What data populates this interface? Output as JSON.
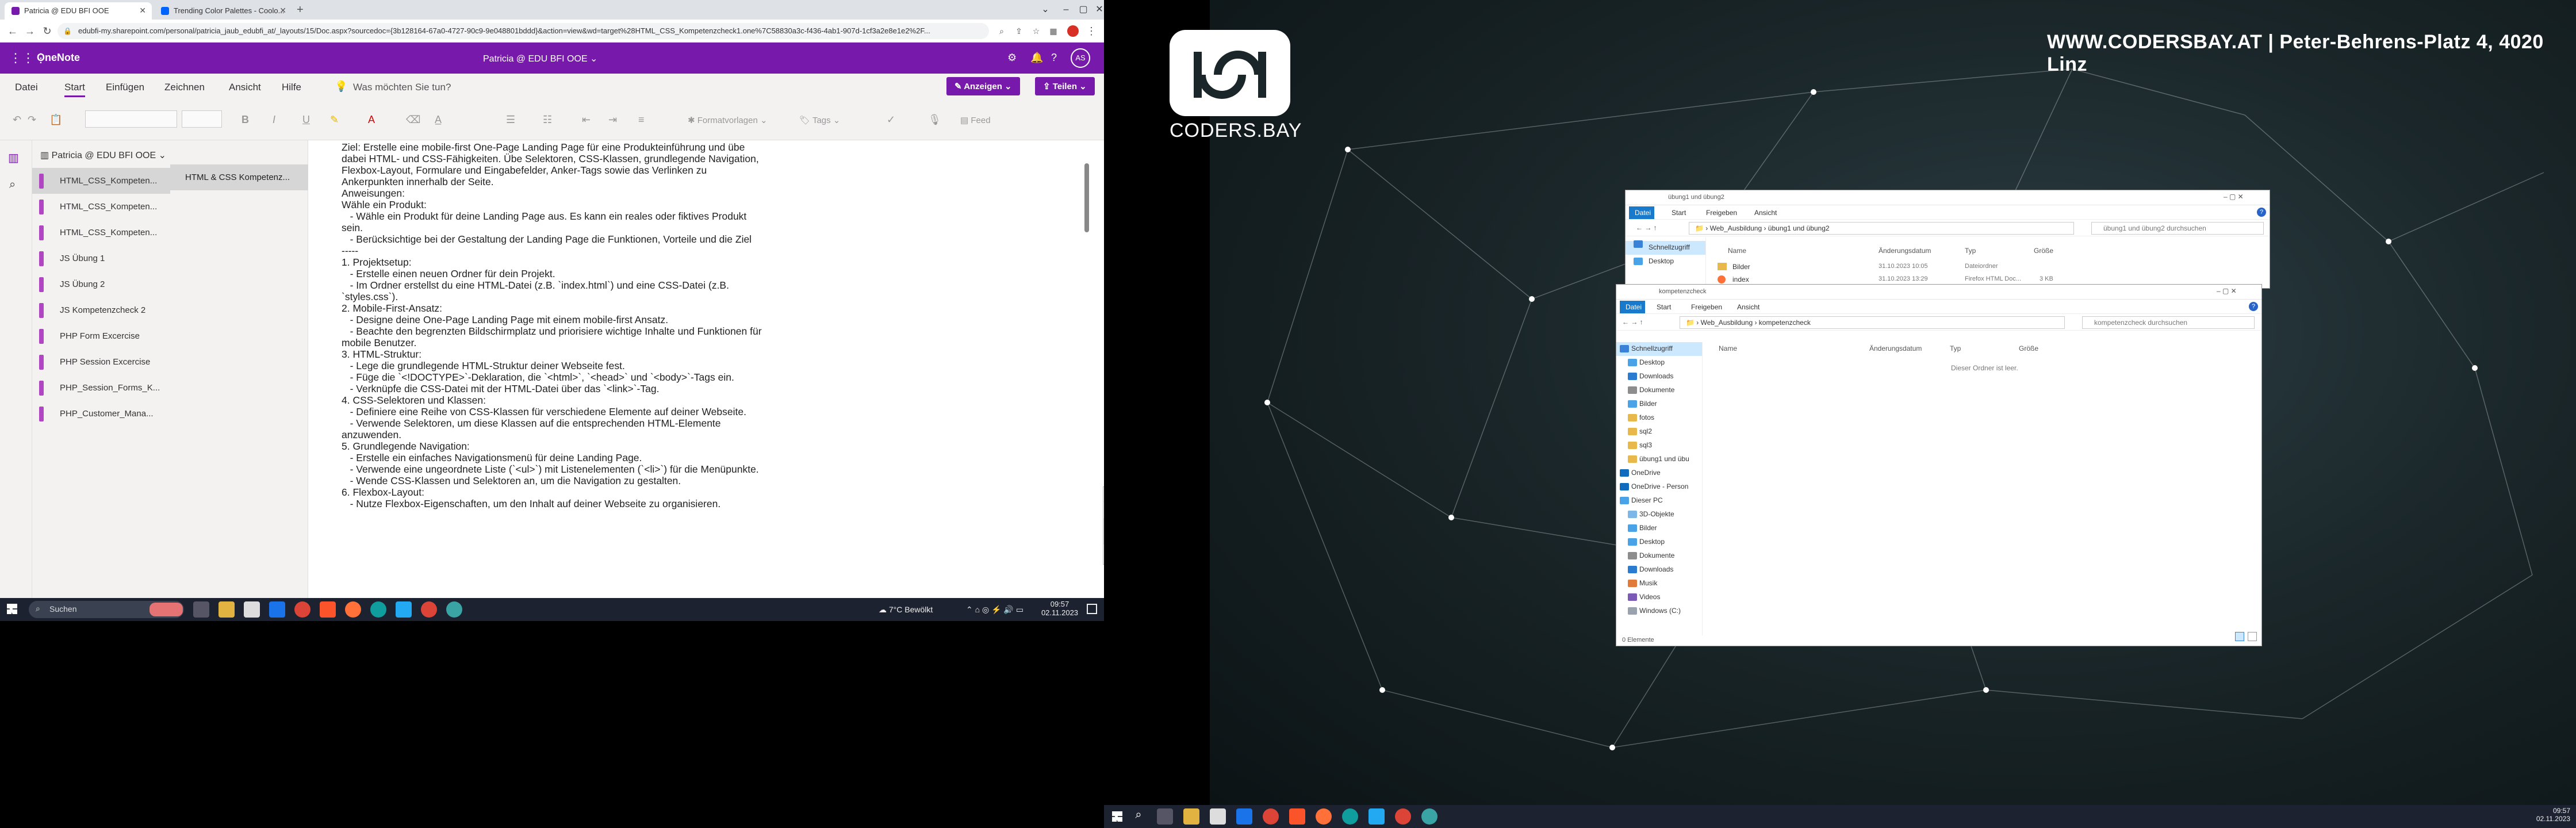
{
  "browser": {
    "tabs": [
      {
        "label": "Patricia @ EDU BFI OOE"
      },
      {
        "label": "Trending Color Palettes - Coolo..."
      }
    ],
    "url": "edubfi-my.sharepoint.com/personal/patricia_jaub_edubfi_at/_layouts/15/Doc.aspx?sourcedoc={3b128164-67a0-4727-90c9-9e048801bddd}&action=view&wd=target%28HTML_CSS_Kompetenzcheck1.one%7C58830a3c-f436-4ab1-907d-1cf3a2e8e1e2%2F..."
  },
  "onenote": {
    "app_name": "OneNote",
    "doc_title": "Patricia @ EDU BFI OOE",
    "avatar": "AS",
    "menu": [
      "Datei",
      "Start",
      "Einfügen",
      "Zeichnen",
      "Ansicht",
      "Hilfe"
    ],
    "search_placeholder": "Was möchten Sie tun?",
    "btn_anzeigen": "Anzeigen",
    "btn_teilen": "Teilen",
    "ribbon_labels": {
      "formatvorlagen": "Formatvorlagen",
      "tags": "Tags",
      "feed": "Feed"
    },
    "notebook": "Patricia @ EDU BFI OOE",
    "sections": [
      "HTML_CSS_Kompeten...",
      "HTML_CSS_Kompeten...",
      "HTML_CSS_Kompeten...",
      "JS Übung 1",
      "JS Übung 2",
      "JS Kompetenzcheck 2",
      "PHP Form Excercise",
      "PHP Session Excercise",
      "PHP_Session_Forms_K...",
      "PHP_Customer_Mana..."
    ],
    "page": "HTML & CSS Kompetenz...",
    "content_lines": [
      "Ziel: Erstelle eine mobile-first One-Page Landing Page für eine Produkteinführung und übe",
      "dabei HTML- und CSS-Fähigkeiten. Übe Selektoren, CSS-Klassen, grundlegende Navigation,",
      "Flexbox-Layout, Formulare und Eingabefelder, Anker-Tags sowie das Verlinken zu",
      "Ankerpunkten innerhalb der Seite.",
      "",
      "Anweisungen:",
      "",
      "Wähle ein Produkt:",
      "   - Wähle ein Produkt für deine Landing Page aus. Es kann ein reales oder fiktives Produkt",
      "sein.",
      "   - Berücksichtige bei der Gestaltung der Landing Page die Funktionen, Vorteile und die Ziel",
      "-----",
      "",
      "1. Projektsetup:",
      "   - Erstelle einen neuen Ordner für dein Projekt.",
      "   - Im Ordner erstellst du eine HTML-Datei (z.B. `index.html`) und eine CSS-Datei (z.B.",
      "`styles.css`).",
      "",
      "2. Mobile-First-Ansatz:",
      "   - Designe deine One-Page Landing Page mit einem mobile-first Ansatz.",
      "   - Beachte den begrenzten Bildschirmplatz und priorisiere wichtige Inhalte und Funktionen für",
      "mobile Benutzer.",
      "",
      "3. HTML-Struktur:",
      "   - Lege die grundlegende HTML-Struktur deiner Webseite fest.",
      "   - Füge die `<!DOCTYPE>`-Deklaration, die `<html>`, `<head>` und `<body>`-Tags ein.",
      "   - Verknüpfe die CSS-Datei mit der HTML-Datei über das `<link>`-Tag.",
      "",
      "4. CSS-Selektoren und Klassen:",
      "   - Definiere eine Reihe von CSS-Klassen für verschiedene Elemente auf deiner Webseite.",
      "   - Verwende Selektoren, um diese Klassen auf die entsprechenden HTML-Elemente",
      "anzuwenden.",
      "",
      "5. Grundlegende Navigation:",
      "   - Erstelle ein einfaches Navigationsmenü für deine Landing Page.",
      "   - Verwende eine ungeordnete Liste (`<ul>`) mit Listenelementen (`<li>`) für die Menüpunkte.",
      "   - Wende CSS-Klassen und Selektoren an, um die Navigation zu gestalten.",
      "",
      "6. Flexbox-Layout:",
      "   - Nutze Flexbox-Eigenschaften, um den Inhalt auf deiner Webseite zu organisieren."
    ]
  },
  "taskbar_left": {
    "search": "Suchen",
    "weather": "7°C  Bewölkt",
    "time": "09:57",
    "date": "02.11.2023"
  },
  "desktop2": {
    "banner": "WWW.CODERSBAY.AT | Peter-Behrens-Platz 4, 4020 Linz",
    "logo_text": "CODERS.BAY",
    "time": "09:57",
    "date": "02.11.2023"
  },
  "explorer_back": {
    "title": "übung1 und übung2",
    "ribbon": [
      "Datei",
      "Start",
      "Freigeben",
      "Ansicht"
    ],
    "path": [
      "Web_Ausbildung",
      "übung1 und übung2"
    ],
    "search": "übung1 und übung2 durchsuchen",
    "columns": [
      "Name",
      "Änderungsdatum",
      "Typ",
      "Größe"
    ],
    "nav": [
      "Schnellzugriff",
      "Desktop"
    ],
    "rows": [
      {
        "name": "Bilder",
        "date": "31.10.2023 10:05",
        "type": "Dateiordner",
        "size": ""
      },
      {
        "name": "index",
        "date": "31.10.2023 13:29",
        "type": "Firefox HTML Doc...",
        "size": "3 KB"
      }
    ]
  },
  "explorer_front": {
    "title": "kompetenzcheck",
    "ribbon": [
      "Datei",
      "Start",
      "Freigeben",
      "Ansicht"
    ],
    "path": [
      "Web_Ausbildung",
      "kompetenzcheck"
    ],
    "search": "kompetenzcheck durchsuchen",
    "columns": [
      "Name",
      "Änderungsdatum",
      "Typ",
      "Größe"
    ],
    "empty": "Dieser Ordner ist leer.",
    "nav": [
      "Schnellzugriff",
      "Desktop",
      "Downloads",
      "Dokumente",
      "Bilder",
      "fotos",
      "sql2",
      "sql3",
      "übung1 und übu",
      "OneDrive",
      "OneDrive - Person",
      "Dieser PC",
      "3D-Objekte",
      "Bilder",
      "Desktop",
      "Dokumente",
      "Downloads",
      "Musik",
      "Videos",
      "Windows (C:)"
    ],
    "status": "0 Elemente"
  }
}
